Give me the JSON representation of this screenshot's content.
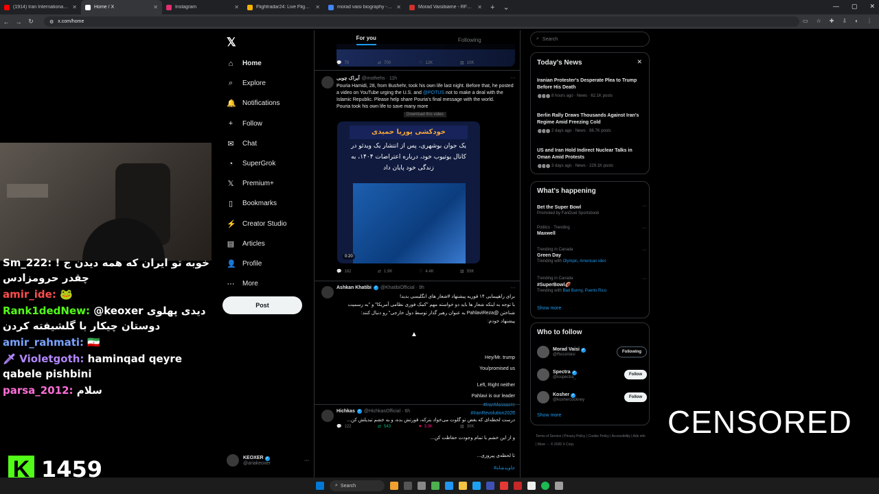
{
  "browser": {
    "tabs": [
      {
        "label": "(1914) Iran International - YouTube",
        "color": "#ff0000",
        "active": false
      },
      {
        "label": "Home / X",
        "color": "#ffffff",
        "active": true
      },
      {
        "label": "Instagram",
        "color": "#e1306c",
        "active": false
      },
      {
        "label": "Flightradar24: Live Flight Tracker",
        "color": "#f5b301",
        "active": false
      },
      {
        "label": "morad vaisi biography - Google Search",
        "color": "#4285f4",
        "active": false
      },
      {
        "label": "Morad Vaisibiame - RFE/RL Author",
        "color": "#d0312d",
        "active": false
      }
    ],
    "url": "x.com/home"
  },
  "stream": {
    "chat": [
      {
        "nick": "Sm_222:",
        "nick_color": "#ffffff",
        "text": "خوبه تو ایران که همه دیدن ج ! چقدر حرومزادس"
      },
      {
        "nick": "amir_ide:",
        "nick_color": "#ff4d4d",
        "text": "🐸"
      },
      {
        "nick": "Rank1dedNew:",
        "nick_color": "#53fc18",
        "text": "@keoxer دیدی پهلوی دوستان چیکار با گلشیفته کردن"
      },
      {
        "nick": "amir_rahmati:",
        "nick_color": "#7aa2ff",
        "text": "🇮🇷"
      },
      {
        "nick": "🗡 Violetgoth:",
        "nick_color": "#b388ff",
        "text": "haminqad qeyre qabele pishbini"
      },
      {
        "nick": "parsa_2012:",
        "nick_color": "#ff6fd8",
        "text": "سلام"
      }
    ],
    "viewer_count": "1459",
    "kick_logo": "K"
  },
  "nav": {
    "logo": "𝕏",
    "items": [
      {
        "label": "Home",
        "icon": "⌂"
      },
      {
        "label": "Explore",
        "icon": "⌕"
      },
      {
        "label": "Notifications",
        "icon": "🔔"
      },
      {
        "label": "Follow",
        "icon": "+"
      },
      {
        "label": "Chat",
        "icon": "✉"
      },
      {
        "label": "SuperGrok",
        "icon": "◔"
      },
      {
        "label": "Premium+",
        "icon": "𝕏"
      },
      {
        "label": "Bookmarks",
        "icon": "▯"
      },
      {
        "label": "Creator Studio",
        "icon": "⚡"
      },
      {
        "label": "Articles",
        "icon": "▤"
      },
      {
        "label": "Profile",
        "icon": "👤"
      },
      {
        "label": "More",
        "icon": "⋯"
      }
    ],
    "post_label": "Post",
    "account": {
      "name": "KEOXER",
      "handle": "@ariakeoxer"
    }
  },
  "feed": {
    "tabs": [
      "For you",
      "Following"
    ],
    "top_actions": [
      "70",
      "700",
      "12K",
      "10K"
    ],
    "tweets": [
      {
        "name": "آیراک چوبی",
        "handle": "@mothehs · 11h",
        "text_en": "Pouria Hamidi, 28, from Bushehr, took his own life last night. Before that, he posted a video on YouTube urging the U.S. and",
        "mention": "@POTUS",
        "text_en2": "not to make a deal with the Islamic Republic. Please help share Pouria's final message with the world.",
        "text_en3": "Pouria took his own life to save many more",
        "media_title": "خودکشی پوریا حمیدی",
        "media_caption": "یک جوان بوشهری، پس از انتشار یک ویدئو در کانال یوتیوب خود، درباره اعتراضات ۱۴۰۴، به زندگی خود پایان داد",
        "duration": "0:20",
        "download": "Download this video",
        "actions": [
          "162",
          "1.9K",
          "4.4K",
          "93K"
        ]
      },
      {
        "name": "Ashkan Khatibi",
        "handle": "@KhatibiOfficial · 9h",
        "lines_fa": [
          "برای راهپیمایی ۱۴ فوریه پیشنهاد #شعار های انگلیسی بدید!",
          "با توجه به اینکه شعار ها باید دو خواسته مهم \"کمک فوری نظامی آمریکا\" و \"به رسمیت",
          "شناختن @PahlaviReza به عنوان رهبر گذار توسط دول خارجی\" رو دنبال کنند:",
          "پیشنهاد خودم:"
        ],
        "lines_en": [
          "Hey/Mr. trump",
          "You/promised us",
          "Left, Right neither",
          "Pahlavi is our leader"
        ],
        "hashtags": [
          "#IranMassacre",
          "#IranRevolution2026"
        ],
        "actions": [
          "122",
          "543",
          "3.3K",
          "30K"
        ]
      },
      {
        "name": "Hichkas",
        "handle": "@HichkasOfficial · 6h",
        "lines_fa": [
          "درست لحظه‌ای که بغض تو گلوت می‌خواد بترکه، قورتش بده، و به خشم تبدیلش کن...",
          "و از این خشم با تمام وجودت حفاظت کن...",
          "تا لحظه‌ی پیروزی..."
        ],
        "hashtags": [
          "#جاویدشاه"
        ]
      }
    ]
  },
  "right": {
    "search_placeholder": "Search",
    "todays_news": {
      "title": "Today's News",
      "items": [
        {
          "title": "Iranian Protester's Desperate Plea to Trump Before His Death",
          "meta": "8 hours ago · News · 62.1K posts"
        },
        {
          "title": "Berlin Rally Draws Thousands Against Iran's Regime Amid Freezing Cold",
          "meta": "2 days ago · News · 98.7K posts"
        },
        {
          "title": "US and Iran Hold Indirect Nuclear Talks in Oman Amid Protests",
          "meta": "3 days ago · News · 229.1K posts"
        }
      ]
    },
    "happening": {
      "title": "What's happening",
      "items": [
        {
          "ctx": "",
          "title": "Bet the Super Bowl",
          "sub": "Promoted by FanDuel Sportsbook"
        },
        {
          "ctx": "Politics · Trending",
          "title": "Maxwell",
          "sub": ""
        },
        {
          "ctx": "Trending in Canada",
          "title": "Green Day",
          "sub": "Trending with",
          "links": "Olympic, American idiot"
        },
        {
          "ctx": "Trending in Canada",
          "title": "#SuperBowl🏈",
          "sub": "Trending with",
          "links": "Bad Bunny, Puerto Rico"
        }
      ],
      "show_more": "Show more"
    },
    "who_to_follow": {
      "title": "Who to follow",
      "users": [
        {
          "name": "Morad Vaisi",
          "handle": "@RezaVaisi",
          "button": "Following"
        },
        {
          "name": "Spectra",
          "handle": "@lospectra_",
          "button": "Follow"
        },
        {
          "name": "Kosher",
          "handle": "@koshercockney",
          "button": "Follow"
        }
      ],
      "show_more": "Show more"
    },
    "footer": "Terms of Service | Privacy Policy | Cookie Policy | Accessibility | Ads info | More ··· © 2026 X Corp."
  },
  "overlay": {
    "censored": "CENSORED"
  },
  "taskbar": {
    "search": "Search"
  }
}
